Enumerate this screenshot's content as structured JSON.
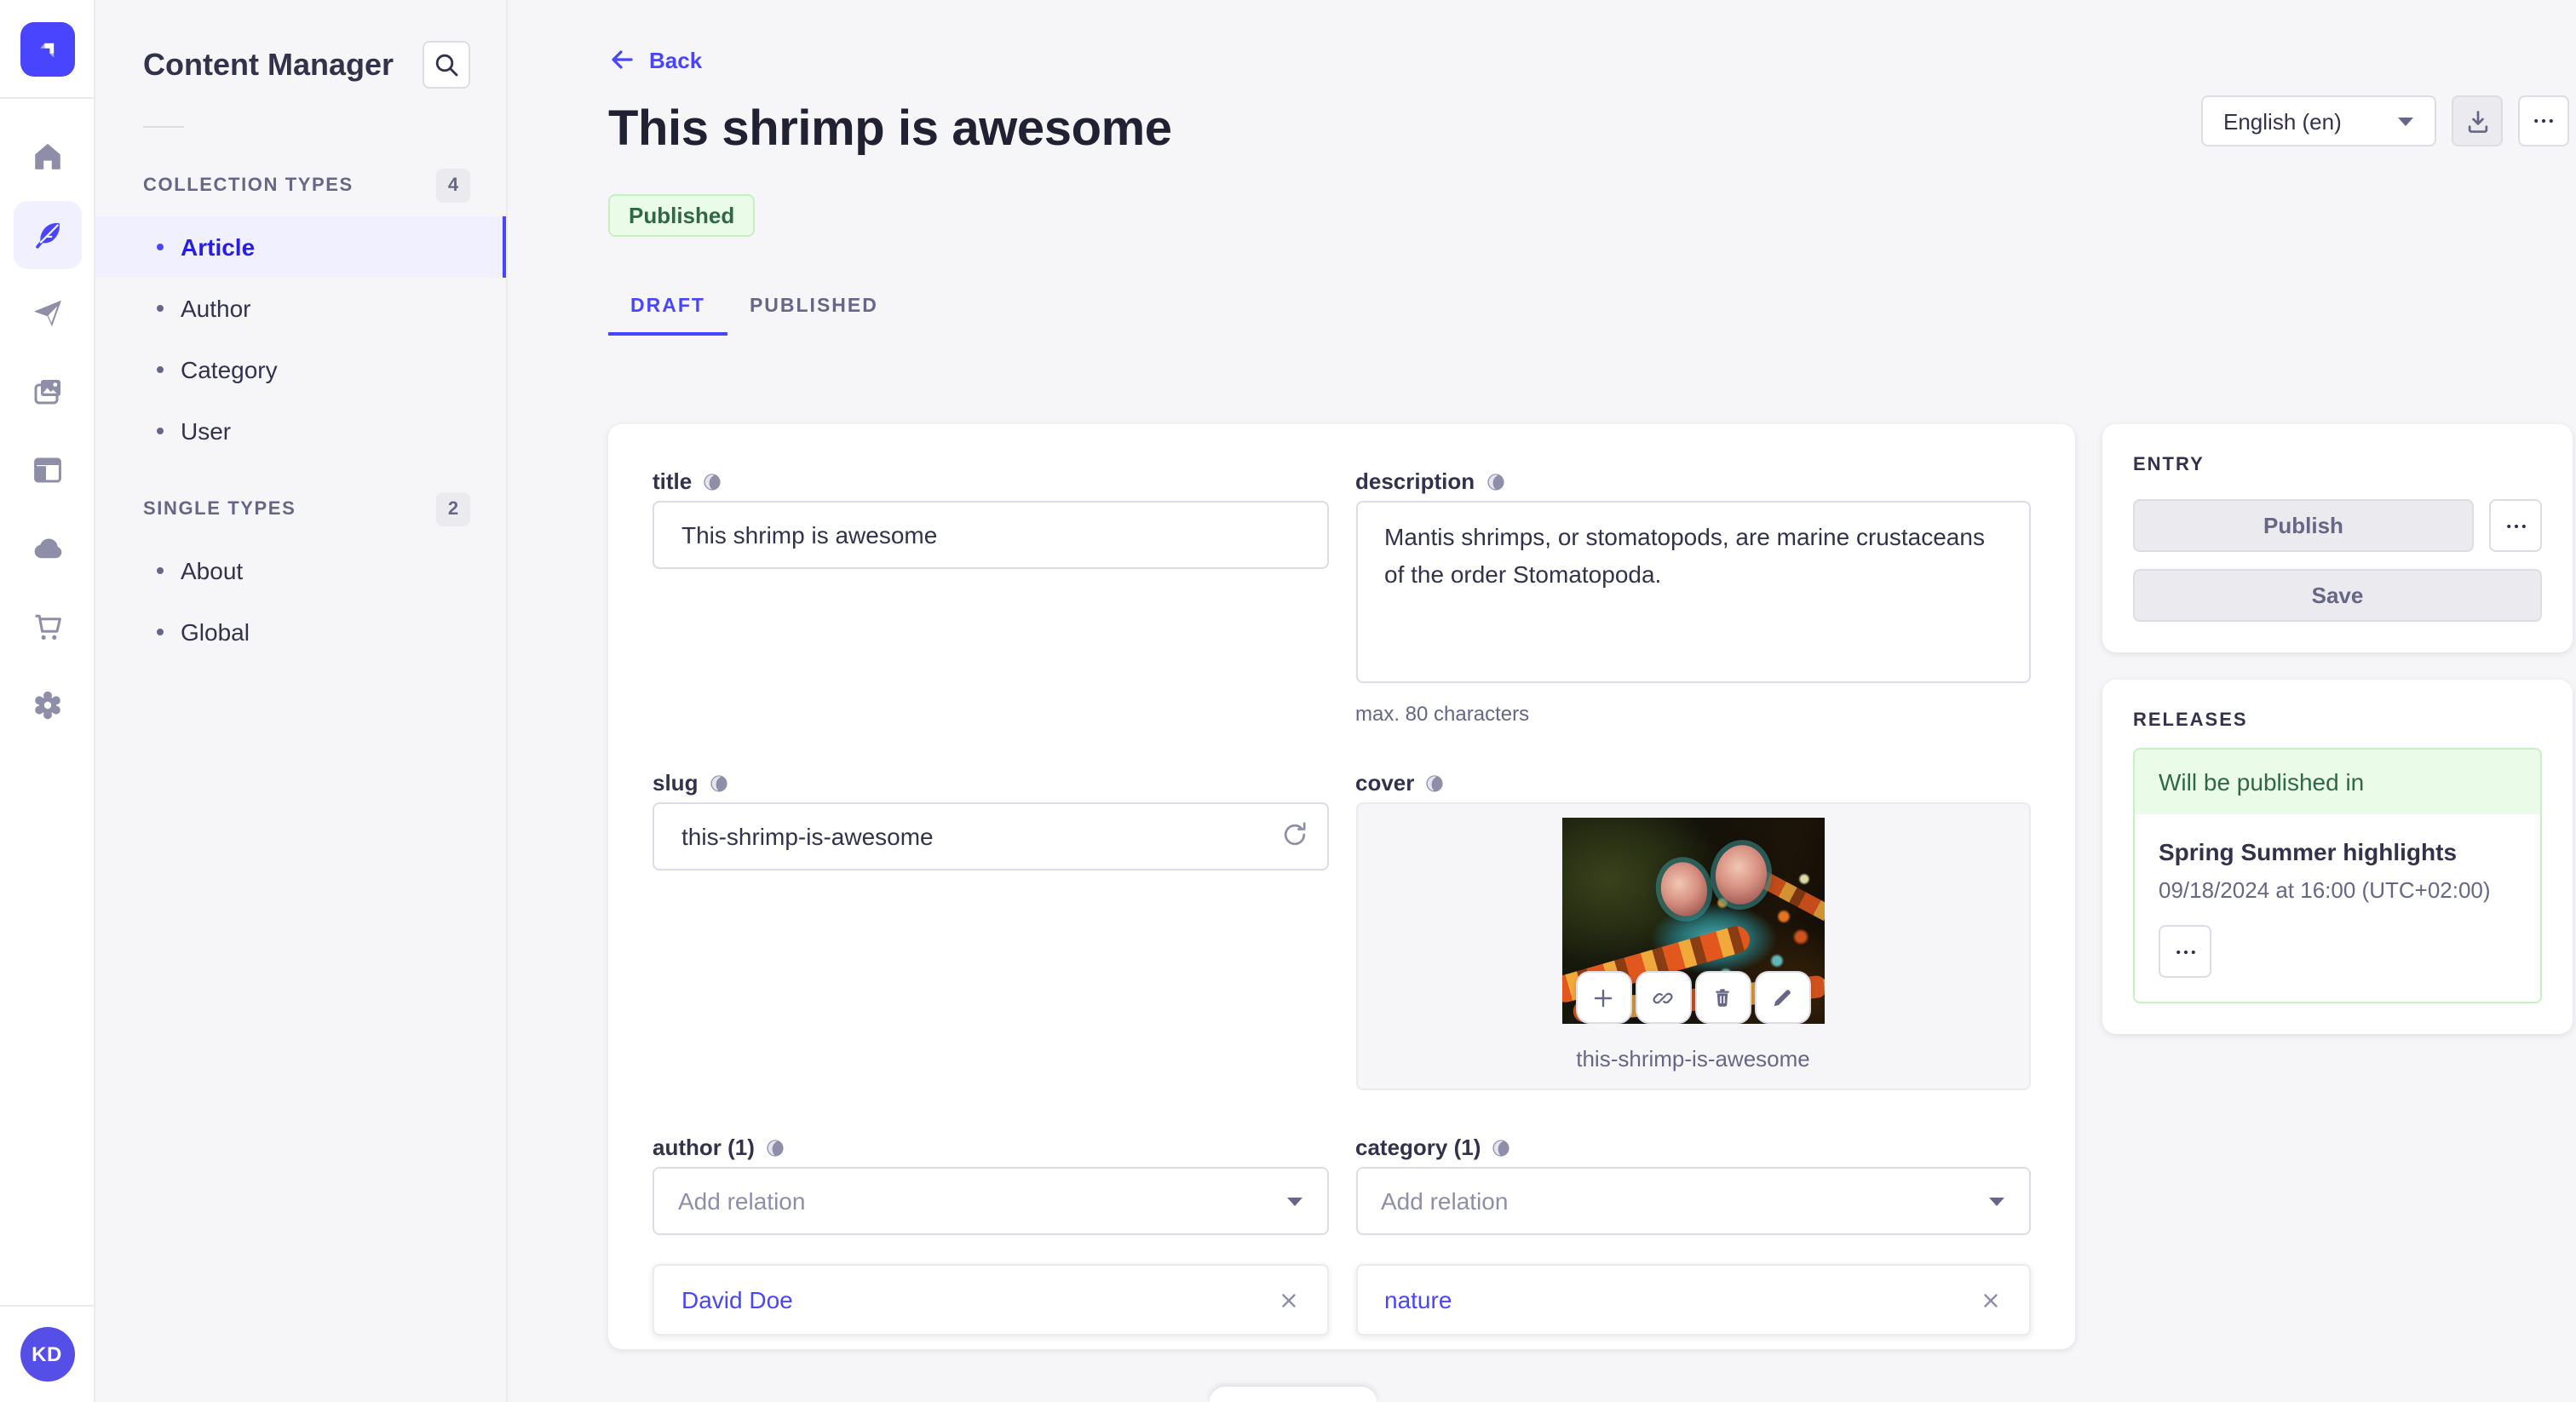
{
  "sidebar": {
    "title": "Content Manager",
    "collection_types": {
      "label": "COLLECTION TYPES",
      "count": "4",
      "items": [
        {
          "label": "Article"
        },
        {
          "label": "Author"
        },
        {
          "label": "Category"
        },
        {
          "label": "User"
        }
      ]
    },
    "single_types": {
      "label": "SINGLE TYPES",
      "count": "2",
      "items": [
        {
          "label": "About"
        },
        {
          "label": "Global"
        }
      ]
    }
  },
  "header": {
    "back_label": "Back",
    "title": "This shrimp is awesome",
    "status": "Published",
    "locale": "English (en)"
  },
  "tabs": {
    "draft": "DRAFT",
    "published": "PUBLISHED"
  },
  "form": {
    "title": {
      "label": "title",
      "value": "This shrimp is awesome"
    },
    "description": {
      "label": "description",
      "value": "Mantis shrimps, or stomatopods, are marine crustaceans of the order Stomatopoda.",
      "helper": "max. 80 characters"
    },
    "slug": {
      "label": "slug",
      "value": "this-shrimp-is-awesome"
    },
    "cover": {
      "label": "cover",
      "caption": "this-shrimp-is-awesome"
    },
    "author": {
      "label": "author (1)",
      "placeholder": "Add relation",
      "relation": "David Doe"
    },
    "category": {
      "label": "category (1)",
      "placeholder": "Add relation",
      "relation": "nature"
    }
  },
  "entry_panel": {
    "heading": "ENTRY",
    "publish_label": "Publish",
    "save_label": "Save"
  },
  "releases_panel": {
    "heading": "RELEASES",
    "status": "Will be published in",
    "release_title": "Spring Summer highlights",
    "release_date": "09/18/2024 at 16:00 (UTC+02:00)"
  },
  "user": {
    "initials": "KD"
  },
  "colors": {
    "primary": "#4945ff",
    "primary_active_text": "#271fe0",
    "success_text": "#2f6846",
    "success_bg": "#eafbe7",
    "success_border": "#c6f0c2"
  }
}
